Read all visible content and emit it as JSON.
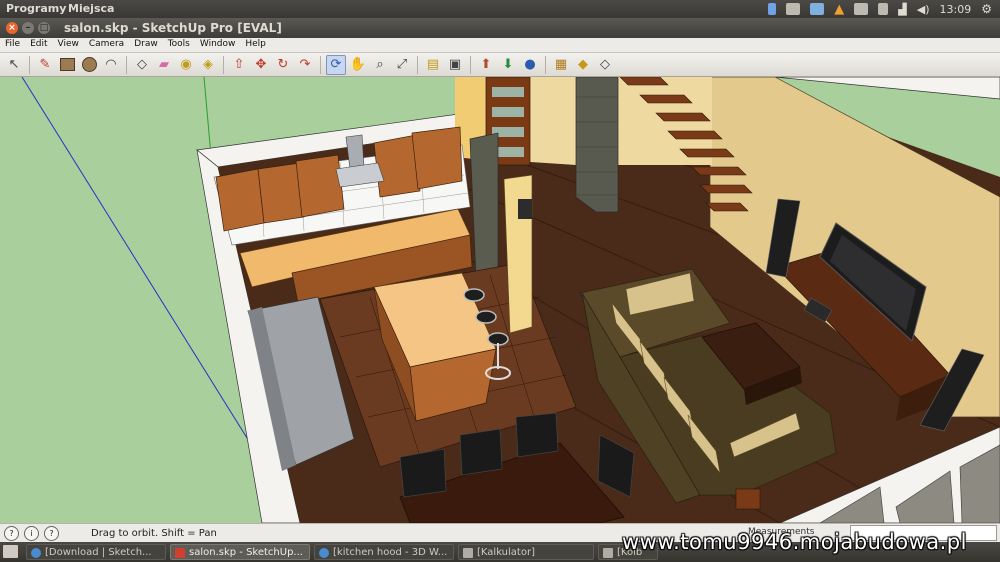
{
  "topbar": {
    "menu_programs": "Programy",
    "menu_places": "Miejsca",
    "clock": "13:09",
    "tray_icons": [
      "bluetooth-icon",
      "mail-envelope-icon",
      "dropbox-icon",
      "warning-icon",
      "email-icon",
      "network-icon",
      "signal-icon",
      "volume-icon"
    ]
  },
  "window": {
    "title": "salon.skp - SketchUp Pro [EVAL]"
  },
  "menubar": {
    "items": [
      "File",
      "Edit",
      "View",
      "Camera",
      "Draw",
      "Tools",
      "Window",
      "Help"
    ]
  },
  "toolbar": {
    "tools": [
      "select",
      "pencil",
      "rectangle",
      "circle",
      "arc",
      "eraser",
      "paint-bucket",
      "push-pull",
      "follow-me",
      "move",
      "rotate",
      "scale",
      "offset",
      "orbit",
      "pan",
      "zoom",
      "zoom-extents",
      "tape-measure",
      "dimension",
      "protractor",
      "text",
      "axes",
      "3d-text",
      "section-plane",
      "get-models",
      "share-model",
      "components"
    ],
    "active_tool": "orbit"
  },
  "statusbar": {
    "hint": "Drag to orbit.  Shift = Pan",
    "measurements_label": "Measurements"
  },
  "taskbar": {
    "items": [
      {
        "label": "[Download | Sketch...",
        "active": false
      },
      {
        "label": "salon.skp - SketchUp...",
        "active": true
      },
      {
        "label": "[kitchen hood - 3D W...",
        "active": false
      },
      {
        "label": "[Kalkulator]",
        "active": false
      },
      {
        "label": "[Kolb",
        "active": false
      }
    ]
  },
  "watermark": "www.tomu9946.mojabudowa.pl",
  "colors": {
    "ground": "#a9cf9c",
    "floor": "#4a2a18",
    "wall_yellow": "#eed9a0",
    "cabinet": "#b4682f",
    "sofa": "#5a4a2a"
  }
}
